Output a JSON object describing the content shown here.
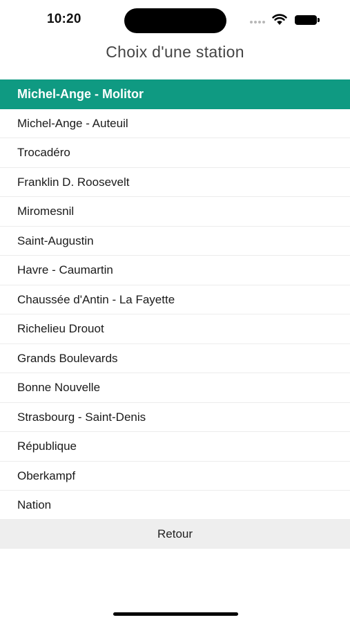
{
  "status_bar": {
    "time": "10:20"
  },
  "header": {
    "title": "Choix d'une station"
  },
  "stations": {
    "selected": "Michel-Ange - Molitor",
    "items": [
      "Michel-Ange - Auteuil",
      "Trocadéro",
      "Franklin D. Roosevelt",
      "Miromesnil",
      "Saint-Augustin",
      "Havre - Caumartin",
      "Chaussée d'Antin - La Fayette",
      "Richelieu Drouot",
      "Grands Boulevards",
      "Bonne Nouvelle",
      "Strasbourg - Saint-Denis",
      "République",
      "Oberkampf",
      "Nation"
    ]
  },
  "footer": {
    "back_label": "Retour"
  },
  "colors": {
    "selected_background": "#0f9a82",
    "back_button_background": "#eeeeee"
  }
}
